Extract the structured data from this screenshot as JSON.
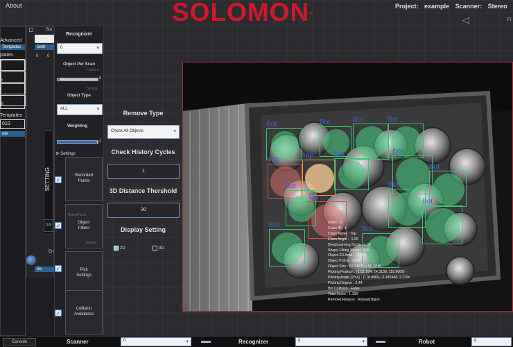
{
  "header": {
    "about": "About",
    "logo": "SOLOMON",
    "project_label": "Project:",
    "project_value": "example",
    "scanner_label": "Scanner:",
    "scanner_value": "Stereo",
    "fl": "Fl"
  },
  "left": {
    "advanced": "Advanced",
    "templates1": "Templates",
    "templates2": "plates",
    "templates3": "Templates",
    "tmpl_value": "010",
    "ate": "ate",
    "sta": "Sta",
    "setting_short": "Setti",
    "zero1": "0",
    "zero2": "0",
    "en": "En",
    "se": "Se",
    "char_p": "P",
    "char_t": "ot"
  },
  "recognizer": {
    "title": "Recognizer",
    "select_value": "0",
    "object_per_scan": "Object Per Scan",
    "object_per_scan_value": "5",
    "capture": "Capture",
    "setting_ghost": "Setting",
    "object_type": "Object Type",
    "object_type_value": "ALL",
    "weighting": "Weighting",
    "weighting_value": "1"
  },
  "setting_tab": {
    "label": "SETTING",
    "collapse": "<<",
    "expand": ">>",
    "settings": "Settings"
  },
  "settings_items": [
    {
      "label": "Recorded\nPoints",
      "checked": true
    },
    {
      "label": "Object\nFilters",
      "checked": true
    },
    {
      "label": "Pick\nSettings",
      "checked": true
    },
    {
      "label": "Collision\nAvoidance",
      "checked": true
    }
  ],
  "ghost": {
    "robotpick": "RobotPickU",
    "setting": "Setting"
  },
  "remove": {
    "remove_type_title": "Remove Type",
    "remove_type_value": "Check All Objects",
    "check_history_title": "Check History Cycles",
    "check_history_value": "1",
    "distance_title": "3D Distance Thershold",
    "distance_value": "30",
    "display_title": "Display Setting",
    "option_2d": "2D",
    "option_3d": "3D",
    "selected": "2D"
  },
  "detections": [
    {
      "label": "Bot",
      "color": "#2ecc71",
      "fill": "rgba(70,210,130,0.55)"
    },
    {
      "label": "Top",
      "color": "#e74c3c",
      "fill": "rgba(255,120,120,0.45)"
    },
    {
      "label": "Top",
      "color": "#f0a040",
      "fill": "rgba(255,210,150,0.75)"
    }
  ],
  "object_info": [
    "Index : 0",
    "Class ID : 1",
    "Class Name : Top",
    "Class Angle : -1.00",
    "DeepLearning Score : 1.00",
    "Shape Fitting Score : 0.95",
    "Object 2D Area : 7228.5",
    "Object Points : 2944",
    "Object Size : 62.31535 x 60.6846",
    "Picking Position : (1111.894, 24.3138, 119.9608)",
    "Picking Angle (ZYX) : (178.9969, -2.182448, 2.112e",
    "Picking Degree : 2.44",
    "Bin Collision : False",
    "Total Score : 1.100",
    "Remove Reason : RepeatObject"
  ],
  "bottom": {
    "console": "Console",
    "scanner": "Scanner",
    "scanner_value": "0",
    "recognizer": "Recognizer",
    "recognizer_value": "0",
    "robot": "Robot",
    "robot_value": "0"
  }
}
